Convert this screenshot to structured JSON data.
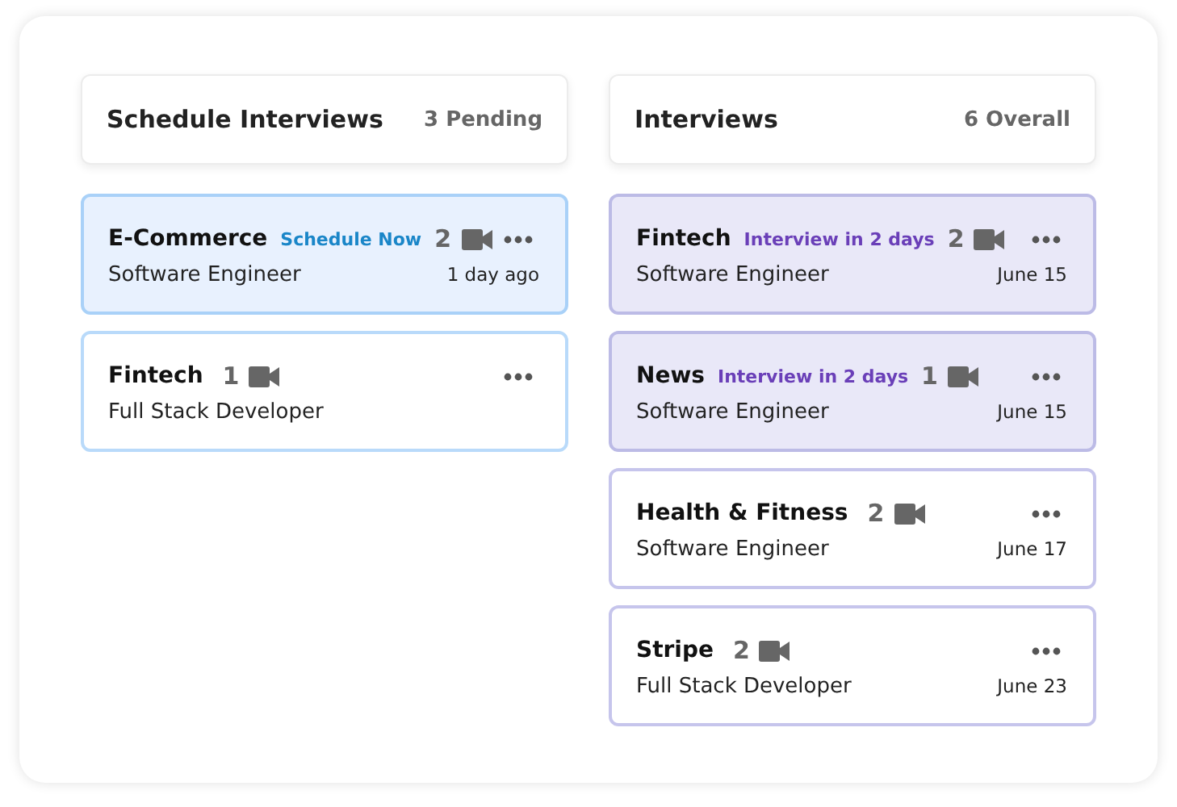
{
  "columns": [
    {
      "kind": "schedule",
      "title": "Schedule Interviews",
      "count": "3 Pending",
      "cards": [
        {
          "company": "E-Commerce",
          "tag": "Schedule Now",
          "videos": "2",
          "role": "Software Engineer",
          "time": "1 day ago",
          "highlighted": true
        },
        {
          "company": "Fintech",
          "videos": "1",
          "role": "Full Stack Developer",
          "highlighted": false
        }
      ]
    },
    {
      "kind": "interviews",
      "title": "Interviews",
      "count": "6 Overall",
      "cards": [
        {
          "company": "Fintech",
          "tag": "Interview in 2 days",
          "videos": "2",
          "role": "Software Engineer",
          "time": "June 15",
          "highlighted": true
        },
        {
          "company": "News",
          "tag": "Interview in 2 days",
          "videos": "1",
          "role": "Software Engineer",
          "time": "June 15",
          "highlighted": true
        },
        {
          "company": "Health & Fitness",
          "videos": "2",
          "role": "Software Engineer",
          "time": "June 17",
          "highlighted": false
        },
        {
          "company": "Stripe",
          "videos": "2",
          "role": "Full Stack Developer",
          "time": "June 23",
          "highlighted": false
        }
      ]
    }
  ]
}
